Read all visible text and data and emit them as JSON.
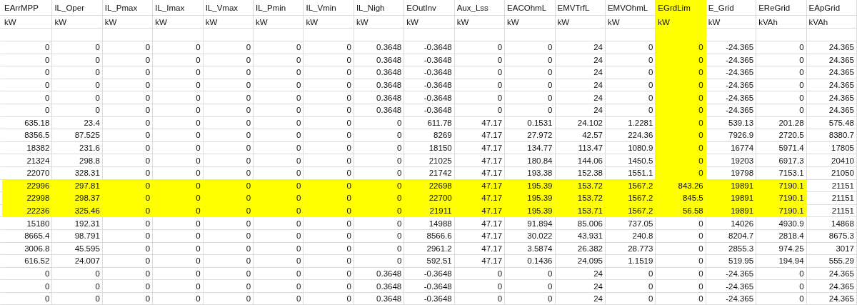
{
  "columns": [
    {
      "name": "EArrMPP",
      "unit": "kW",
      "highlighted": false
    },
    {
      "name": "IL_Oper",
      "unit": "kW",
      "highlighted": false
    },
    {
      "name": "IL_Pmax",
      "unit": "kW",
      "highlighted": false
    },
    {
      "name": "IL_Imax",
      "unit": "kW",
      "highlighted": false
    },
    {
      "name": "IL_Vmax",
      "unit": "kW",
      "highlighted": false
    },
    {
      "name": "IL_Pmin",
      "unit": "kW",
      "highlighted": false
    },
    {
      "name": "IL_Vmin",
      "unit": "kW",
      "highlighted": false
    },
    {
      "name": "IL_Nigh",
      "unit": "kW",
      "highlighted": false
    },
    {
      "name": "EOutInv",
      "unit": "kW",
      "highlighted": false
    },
    {
      "name": "Aux_Lss",
      "unit": "kW",
      "highlighted": false
    },
    {
      "name": "EACOhmL",
      "unit": "kW",
      "highlighted": false
    },
    {
      "name": "EMVTrfL",
      "unit": "kW",
      "highlighted": false
    },
    {
      "name": "EMVOhmL",
      "unit": "kW",
      "highlighted": false
    },
    {
      "name": "EGrdLim",
      "unit": "kW",
      "highlighted": true
    },
    {
      "name": "E_Grid",
      "unit": "kW",
      "highlighted": false
    },
    {
      "name": "EReGrid",
      "unit": "kVAh",
      "highlighted": false
    },
    {
      "name": "EApGrid",
      "unit": "kVAh",
      "highlighted": false
    }
  ],
  "rows": [
    {
      "cells": [
        "0",
        "0",
        "0",
        "0",
        "0",
        "0",
        "0",
        "0.3648",
        "-0.3648",
        "0",
        "0",
        "24",
        "0",
        "0",
        "-24.365",
        "0",
        "24.365"
      ],
      "highlighted": [
        false,
        false,
        false,
        false,
        false,
        false,
        false,
        false,
        false,
        false,
        false,
        false,
        false,
        true,
        false,
        false,
        false
      ]
    },
    {
      "cells": [
        "0",
        "0",
        "0",
        "0",
        "0",
        "0",
        "0",
        "0.3648",
        "-0.3648",
        "0",
        "0",
        "24",
        "0",
        "0",
        "-24.365",
        "0",
        "24.365"
      ],
      "highlighted": [
        false,
        false,
        false,
        false,
        false,
        false,
        false,
        false,
        false,
        false,
        false,
        false,
        false,
        true,
        false,
        false,
        false
      ]
    },
    {
      "cells": [
        "0",
        "0",
        "0",
        "0",
        "0",
        "0",
        "0",
        "0.3648",
        "-0.3648",
        "0",
        "0",
        "24",
        "0",
        "0",
        "-24.365",
        "0",
        "24.365"
      ],
      "highlighted": [
        false,
        false,
        false,
        false,
        false,
        false,
        false,
        false,
        false,
        false,
        false,
        false,
        false,
        true,
        false,
        false,
        false
      ]
    },
    {
      "cells": [
        "0",
        "0",
        "0",
        "0",
        "0",
        "0",
        "0",
        "0.3648",
        "-0.3648",
        "0",
        "0",
        "24",
        "0",
        "0",
        "-24.365",
        "0",
        "24.365"
      ],
      "highlighted": [
        false,
        false,
        false,
        false,
        false,
        false,
        false,
        false,
        false,
        false,
        false,
        false,
        false,
        true,
        false,
        false,
        false
      ]
    },
    {
      "cells": [
        "0",
        "0",
        "0",
        "0",
        "0",
        "0",
        "0",
        "0.3648",
        "-0.3648",
        "0",
        "0",
        "24",
        "0",
        "0",
        "-24.365",
        "0",
        "24.365"
      ],
      "highlighted": [
        false,
        false,
        false,
        false,
        false,
        false,
        false,
        false,
        false,
        false,
        false,
        false,
        false,
        true,
        false,
        false,
        false
      ]
    },
    {
      "cells": [
        "0",
        "0",
        "0",
        "0",
        "0",
        "0",
        "0",
        "0.3648",
        "-0.3648",
        "0",
        "0",
        "24",
        "0",
        "0",
        "-24.365",
        "0",
        "24.365"
      ],
      "highlighted": [
        false,
        false,
        false,
        false,
        false,
        false,
        false,
        false,
        false,
        false,
        false,
        false,
        false,
        true,
        false,
        false,
        false
      ]
    },
    {
      "cells": [
        "635.18",
        "23.4",
        "0",
        "0",
        "0",
        "0",
        "0",
        "0",
        "611.78",
        "47.17",
        "0.1531",
        "24.102",
        "1.2281",
        "0",
        "539.13",
        "201.28",
        "575.48"
      ],
      "highlighted": [
        false,
        false,
        false,
        false,
        false,
        false,
        false,
        false,
        false,
        false,
        false,
        false,
        false,
        true,
        false,
        false,
        false
      ]
    },
    {
      "cells": [
        "8356.5",
        "87.525",
        "0",
        "0",
        "0",
        "0",
        "0",
        "0",
        "8269",
        "47.17",
        "27.972",
        "42.57",
        "224.36",
        "0",
        "7926.9",
        "2720.5",
        "8380.7"
      ],
      "highlighted": [
        false,
        false,
        false,
        false,
        false,
        false,
        false,
        false,
        false,
        false,
        false,
        false,
        false,
        true,
        false,
        false,
        false
      ]
    },
    {
      "cells": [
        "18382",
        "231.6",
        "0",
        "0",
        "0",
        "0",
        "0",
        "0",
        "18150",
        "47.17",
        "134.77",
        "113.47",
        "1080.9",
        "0",
        "16774",
        "5971.4",
        "17805"
      ],
      "highlighted": [
        false,
        false,
        false,
        false,
        false,
        false,
        false,
        false,
        false,
        false,
        false,
        false,
        false,
        true,
        false,
        false,
        false
      ]
    },
    {
      "cells": [
        "21324",
        "298.8",
        "0",
        "0",
        "0",
        "0",
        "0",
        "0",
        "21025",
        "47.17",
        "180.84",
        "144.06",
        "1450.5",
        "0",
        "19203",
        "6917.3",
        "20410"
      ],
      "highlighted": [
        false,
        false,
        false,
        false,
        false,
        false,
        false,
        false,
        false,
        false,
        false,
        false,
        false,
        true,
        false,
        false,
        false
      ]
    },
    {
      "cells": [
        "22070",
        "328.31",
        "0",
        "0",
        "0",
        "0",
        "0",
        "0",
        "21742",
        "47.17",
        "193.38",
        "152.38",
        "1551.1",
        "0",
        "19798",
        "7153.1",
        "21050"
      ],
      "highlighted": [
        false,
        false,
        false,
        false,
        false,
        false,
        false,
        false,
        false,
        false,
        false,
        false,
        false,
        true,
        false,
        false,
        false
      ]
    },
    {
      "cells": [
        "22996",
        "297.81",
        "0",
        "0",
        "0",
        "0",
        "0",
        "0",
        "22698",
        "47.17",
        "195.39",
        "153.72",
        "1567.2",
        "843.26",
        "19891",
        "7190.1",
        "21151"
      ],
      "highlighted": [
        true,
        true,
        true,
        true,
        true,
        true,
        true,
        true,
        true,
        true,
        true,
        true,
        true,
        true,
        true,
        true,
        false
      ]
    },
    {
      "cells": [
        "22998",
        "298.37",
        "0",
        "0",
        "0",
        "0",
        "0",
        "0",
        "22700",
        "47.17",
        "195.39",
        "153.72",
        "1567.2",
        "845.5",
        "19891",
        "7190.1",
        "21151"
      ],
      "highlighted": [
        true,
        true,
        true,
        true,
        true,
        true,
        true,
        true,
        true,
        true,
        true,
        true,
        true,
        true,
        true,
        true,
        false
      ]
    },
    {
      "cells": [
        "22236",
        "325.46",
        "0",
        "0",
        "0",
        "0",
        "0",
        "0",
        "21911",
        "47.17",
        "195.39",
        "153.71",
        "1567.2",
        "56.58",
        "19891",
        "7190.1",
        "21151"
      ],
      "highlighted": [
        true,
        true,
        true,
        true,
        true,
        true,
        true,
        true,
        true,
        true,
        true,
        true,
        true,
        true,
        true,
        true,
        false
      ]
    },
    {
      "cells": [
        "15180",
        "192.31",
        "0",
        "0",
        "0",
        "0",
        "0",
        "0",
        "14988",
        "47.17",
        "91.894",
        "85.006",
        "737.05",
        "0",
        "14026",
        "4930.9",
        "14868"
      ],
      "highlighted": [
        false,
        false,
        false,
        false,
        false,
        false,
        false,
        false,
        false,
        false,
        false,
        false,
        false,
        false,
        false,
        false,
        false
      ]
    },
    {
      "cells": [
        "8665.4",
        "98.791",
        "0",
        "0",
        "0",
        "0",
        "0",
        "0",
        "8566.6",
        "47.17",
        "30.022",
        "43.931",
        "240.8",
        "0",
        "8204.7",
        "2818.4",
        "8675.3"
      ],
      "highlighted": [
        false,
        false,
        false,
        false,
        false,
        false,
        false,
        false,
        false,
        false,
        false,
        false,
        false,
        false,
        false,
        false,
        false
      ]
    },
    {
      "cells": [
        "3006.8",
        "45.595",
        "0",
        "0",
        "0",
        "0",
        "0",
        "0",
        "2961.2",
        "47.17",
        "3.5874",
        "26.382",
        "28.773",
        "0",
        "2855.3",
        "974.25",
        "3017"
      ],
      "highlighted": [
        false,
        false,
        false,
        false,
        false,
        false,
        false,
        false,
        false,
        false,
        false,
        false,
        false,
        false,
        false,
        false,
        false
      ]
    },
    {
      "cells": [
        "616.52",
        "24.007",
        "0",
        "0",
        "0",
        "0",
        "0",
        "0",
        "592.51",
        "47.17",
        "0.1436",
        "24.095",
        "1.1519",
        "0",
        "519.95",
        "194.94",
        "555.29"
      ],
      "highlighted": [
        false,
        false,
        false,
        false,
        false,
        false,
        false,
        false,
        false,
        false,
        false,
        false,
        false,
        false,
        false,
        false,
        false
      ]
    },
    {
      "cells": [
        "0",
        "0",
        "0",
        "0",
        "0",
        "0",
        "0",
        "0.3648",
        "-0.3648",
        "0",
        "0",
        "24",
        "0",
        "0",
        "-24.365",
        "0",
        "24.365"
      ],
      "highlighted": [
        false,
        false,
        false,
        false,
        false,
        false,
        false,
        false,
        false,
        false,
        false,
        false,
        false,
        false,
        false,
        false,
        false
      ]
    },
    {
      "cells": [
        "0",
        "0",
        "0",
        "0",
        "0",
        "0",
        "0",
        "0.3648",
        "-0.3648",
        "0",
        "0",
        "24",
        "0",
        "0",
        "-24.365",
        "0",
        "24.365"
      ],
      "highlighted": [
        false,
        false,
        false,
        false,
        false,
        false,
        false,
        false,
        false,
        false,
        false,
        false,
        false,
        false,
        false,
        false,
        false
      ]
    },
    {
      "cells": [
        "0",
        "0",
        "0",
        "0",
        "0",
        "0",
        "0",
        "0.3648",
        "-0.3648",
        "0",
        "0",
        "24",
        "0",
        "0",
        "-24.365",
        "0",
        "24.365"
      ],
      "highlighted": [
        false,
        false,
        false,
        false,
        false,
        false,
        false,
        false,
        false,
        false,
        false,
        false,
        false,
        false,
        false,
        false,
        false
      ]
    }
  ]
}
